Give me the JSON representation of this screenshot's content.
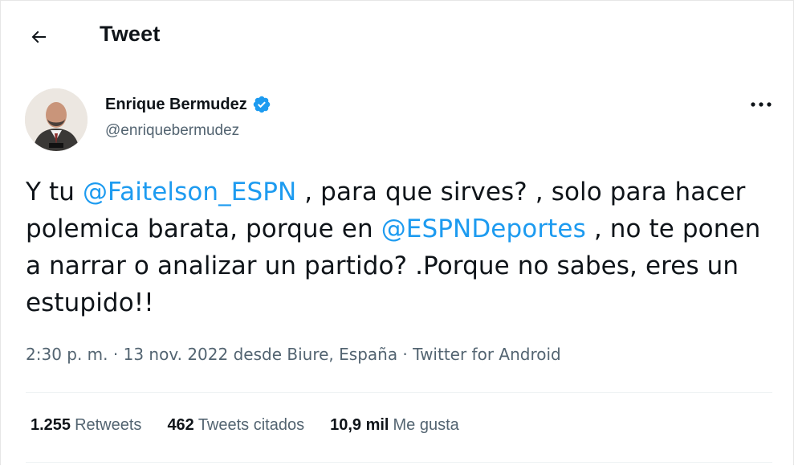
{
  "header": {
    "title": "Tweet",
    "back_icon": "arrow-left-icon"
  },
  "author": {
    "name": "Enrique Bermudez",
    "handle": "@enriquebermudez",
    "verified": true,
    "verified_icon": "verified-badge-icon",
    "avatar_icon": "avatar"
  },
  "more_icon": "more-options-icon",
  "tweet": {
    "segments": [
      {
        "text": "Y tu ",
        "type": "text"
      },
      {
        "text": "@Faitelson_ESPN",
        "type": "mention"
      },
      {
        "text": " , para que sirves? , solo para hacer polemica barata, porque en ",
        "type": "text"
      },
      {
        "text": "@ESPNDeportes",
        "type": "mention"
      },
      {
        "text": " , no te ponen a narrar o analizar un partido? .Porque no sabes, eres un estupido!!",
        "type": "text"
      }
    ]
  },
  "meta": {
    "time": "2:30 p. m.",
    "sep1": " · ",
    "date": "13 nov. 2022",
    "location_prefix": " desde ",
    "location": "Biure, España",
    "sep2": " · ",
    "source": "Twitter for Android"
  },
  "stats": {
    "retweets_count": "1.255",
    "retweets_label": "Retweets",
    "quotes_count": "462",
    "quotes_label": "Tweets citados",
    "likes_count": "10,9 mil",
    "likes_label": "Me gusta"
  },
  "colors": {
    "accent": "#1d9bf0",
    "text_primary": "#0f1419",
    "text_secondary": "#536471",
    "divider": "#eff3f4"
  }
}
